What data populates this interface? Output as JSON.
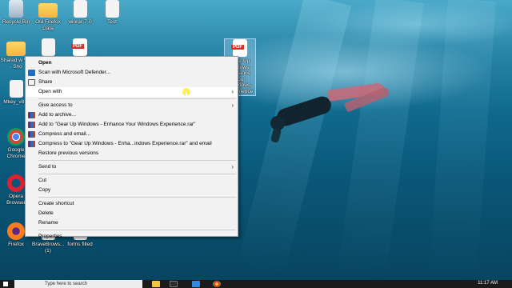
{
  "desktop": {
    "icons": [
      {
        "label": "Recycle Bin",
        "type": "recycle-bin"
      },
      {
        "label": "Old Firefox Data",
        "type": "folder"
      },
      {
        "label": "winrar-7-0",
        "type": "file"
      },
      {
        "label": "Test",
        "type": "file"
      },
      {
        "label": "Shared w VM - Sho",
        "type": "folder"
      },
      {
        "label": "",
        "type": "file"
      },
      {
        "label": "",
        "type": "pdf"
      },
      {
        "label": "Gear Up Windows - Enhance Your Windows Experience",
        "type": "pdf",
        "selected": true
      },
      {
        "label": "Mkey_v8...",
        "type": "file"
      },
      {
        "label": "Google Chrome",
        "type": "chrome"
      },
      {
        "label": "Opera Browser",
        "type": "opera"
      },
      {
        "label": "Firefox",
        "type": "firefox"
      },
      {
        "label": "BraveBrows... (1)",
        "type": "file"
      },
      {
        "label": "forms filled",
        "type": "file"
      }
    ]
  },
  "context_menu": {
    "items": [
      {
        "label": "Open",
        "bold": true,
        "icon": ""
      },
      {
        "label": "Scan with Microsoft Defender...",
        "icon": "defender-icon"
      },
      {
        "label": "Share",
        "icon": "share-icon"
      },
      {
        "label": "Open with",
        "icon": "",
        "submenu": true,
        "highlighted": true
      },
      {
        "separator": true
      },
      {
        "label": "Give access to",
        "icon": "",
        "submenu": true
      },
      {
        "label": "Add to archive...",
        "icon": "winrar-icon"
      },
      {
        "label": "Add to \"Gear Up Windows - Enhance Your Windows Experience.rar\"",
        "icon": "winrar-icon"
      },
      {
        "label": "Compress and email...",
        "icon": "winrar-icon"
      },
      {
        "label": "Compress to \"Gear Up Windows - Enha...indows Experience.rar\" and email",
        "icon": "winrar-icon"
      },
      {
        "label": "Restore previous versions",
        "icon": ""
      },
      {
        "separator": true
      },
      {
        "label": "Send to",
        "icon": "",
        "submenu": true
      },
      {
        "separator": true
      },
      {
        "label": "Cut",
        "icon": ""
      },
      {
        "label": "Copy",
        "icon": ""
      },
      {
        "separator": true
      },
      {
        "label": "Create shortcut",
        "icon": ""
      },
      {
        "label": "Delete",
        "icon": ""
      },
      {
        "label": "Rename",
        "icon": ""
      },
      {
        "separator": true
      },
      {
        "label": "Properties",
        "icon": ""
      }
    ],
    "submenu_arrow": "›"
  },
  "taskbar": {
    "search_placeholder": "Type here to search",
    "time": "11:17 AM"
  },
  "colors": {
    "menu_bg": "#f2f2f2",
    "menu_highlight": "#ffffff",
    "taskbar": "#1b1b1b",
    "cursor_highlight": "#ffeb3c"
  }
}
